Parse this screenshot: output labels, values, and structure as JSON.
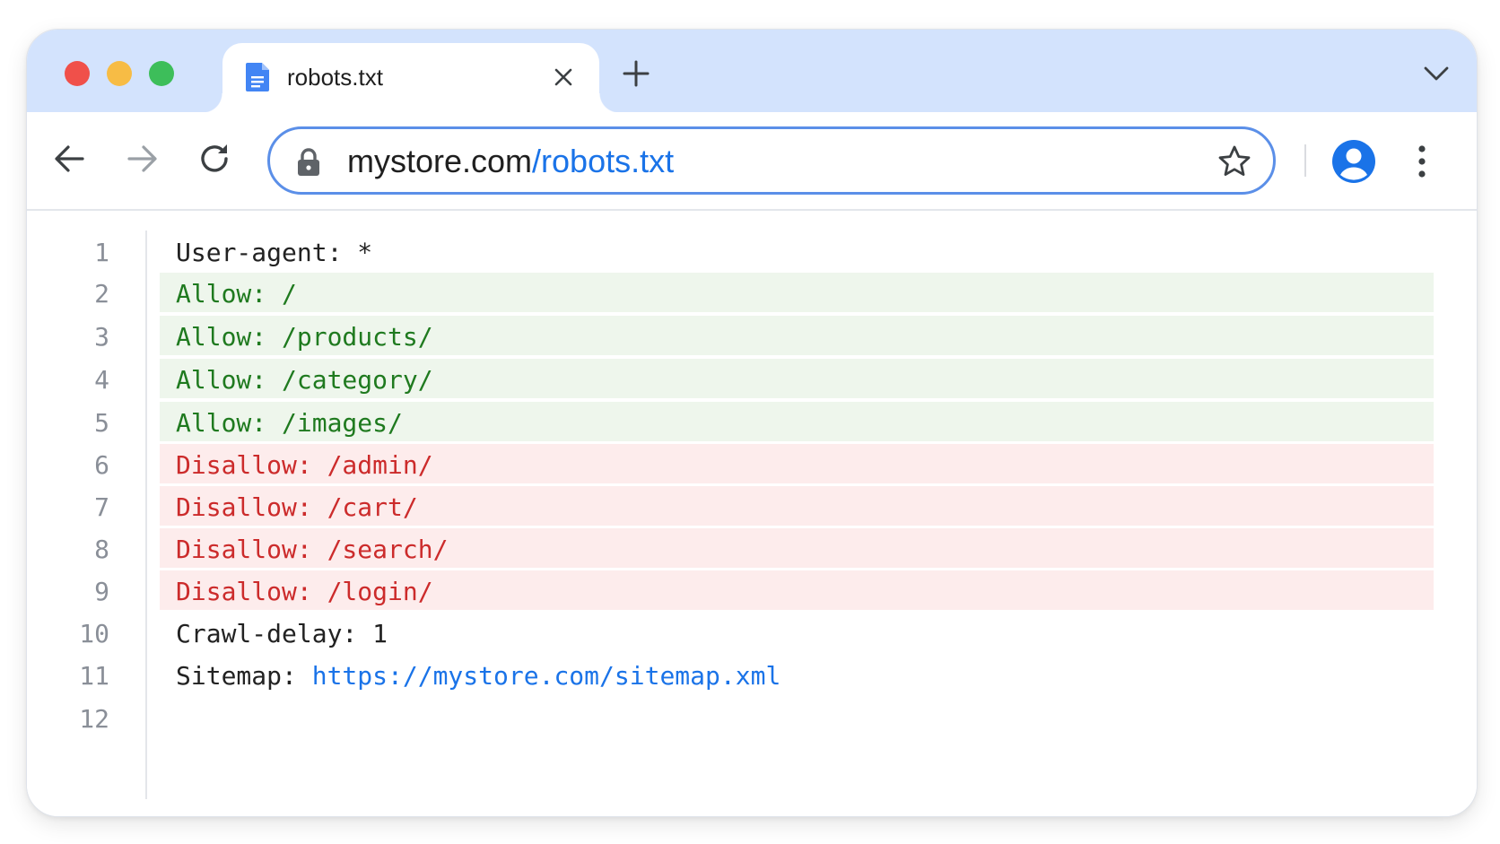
{
  "browser": {
    "tab": {
      "title": "robots.txt",
      "icon": "document-icon"
    },
    "address_bar": {
      "domain": "mystore.com",
      "path": "/robots.txt"
    },
    "accent_color": "#1a73e8"
  },
  "file": {
    "lines": [
      {
        "num": "1",
        "text": "User-agent: *"
      },
      {
        "num": "2",
        "text": "Allow: /"
      },
      {
        "num": "3",
        "text": "Allow: /products/"
      },
      {
        "num": "4",
        "text": "Allow: /category/"
      },
      {
        "num": "5",
        "text": "Allow: /images/"
      },
      {
        "num": "6",
        "text": "Disallow: /admin/"
      },
      {
        "num": "7",
        "text": "Disallow: /cart/"
      },
      {
        "num": "8",
        "text": "Disallow: /search/"
      },
      {
        "num": "9",
        "text": "Disallow: /login/"
      },
      {
        "num": "10",
        "text": "Crawl-delay: 1"
      },
      {
        "num": "11",
        "label": "Sitemap: ",
        "link": "https://mystore.com/sitemap.xml"
      },
      {
        "num": "12",
        "text": ""
      }
    ],
    "colors": {
      "allow_text": "#1f7a1f",
      "allow_bg": "#eef6ec",
      "disallow_text": "#cc2b2b",
      "disallow_bg": "#fdecec"
    }
  }
}
